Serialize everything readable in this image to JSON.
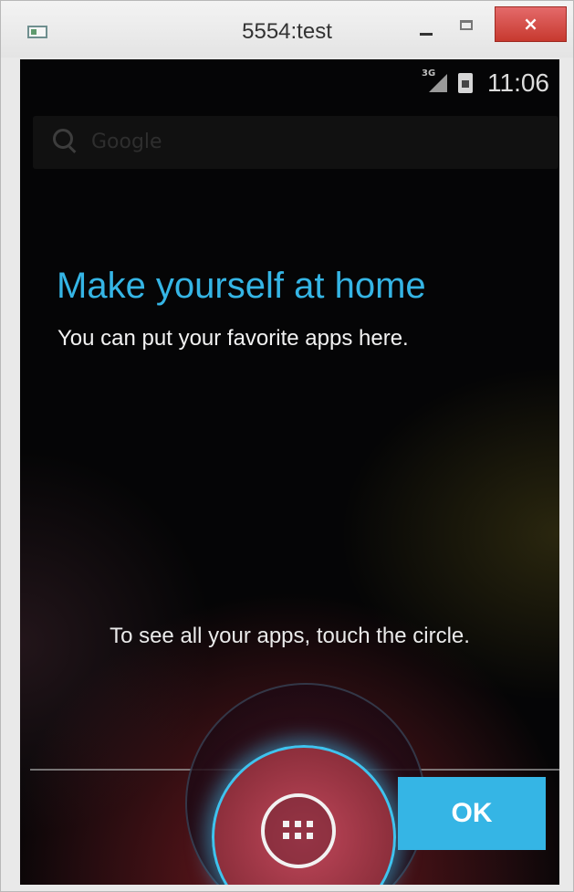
{
  "window": {
    "title": "5554:test",
    "close_glyph": "×",
    "minimize_icon": "minimize-icon",
    "maximize_icon": "maximize-icon"
  },
  "status_bar": {
    "network_label": "3G",
    "time": "11:06",
    "icons": [
      "signal-icon",
      "battery-icon"
    ]
  },
  "search": {
    "placeholder": "Google",
    "icon": "search-icon"
  },
  "cling": {
    "title": "Make yourself at home",
    "subtitle": "You can put your favorite apps here.",
    "hint": "To see all your apps, touch the circle.",
    "ok_label": "OK",
    "all_apps_icon": "all-apps-icon"
  },
  "colors": {
    "accent": "#35b5e5",
    "close_button": "#d6493f",
    "screen_bg": "#050506"
  }
}
